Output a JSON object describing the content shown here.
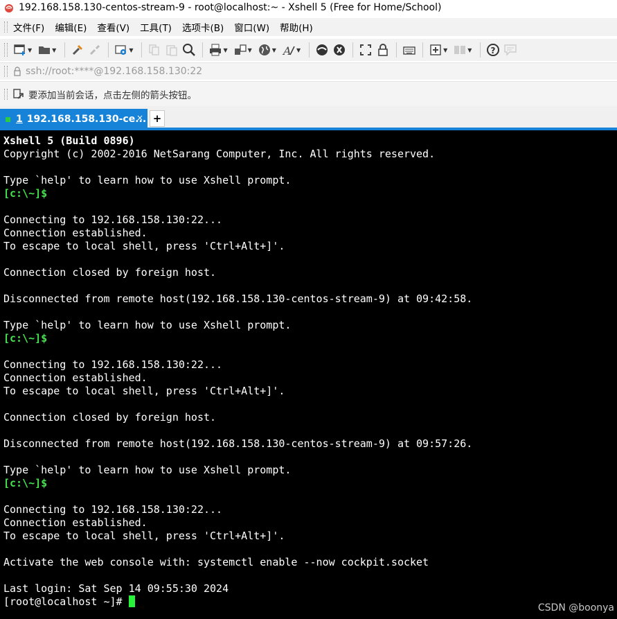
{
  "window": {
    "title": "192.168.158.130-centos-stream-9 - root@localhost:~ - Xshell 5 (Free for Home/School)",
    "app_icon": "xshell-icon"
  },
  "menu": [
    "文件(F)",
    "编辑(E)",
    "查看(V)",
    "工具(T)",
    "选项卡(B)",
    "窗口(W)",
    "帮助(H)"
  ],
  "toolbar": {
    "icons": [
      "new-session-icon",
      "open-folder-icon",
      "connect-icon",
      "disconnect-icon",
      "properties-icon",
      "copy-icon",
      "paste-icon",
      "find-icon",
      "print-icon",
      "transfer-icon",
      "globe-icon",
      "font-icon",
      "xftp-icon",
      "xmanager-icon",
      "fullscreen-icon",
      "lock-icon",
      "keyboard-icon",
      "add-tab-icon",
      "layout-icon",
      "help-icon",
      "chat-icon"
    ]
  },
  "address": {
    "icon": "lock-icon",
    "value": "ssh://root:****@192.168.158.130:22"
  },
  "hint": {
    "icon": "arrow-icon",
    "text": "要添加当前会话，点击左侧的箭头按钮。"
  },
  "tab": {
    "number": "1",
    "label": "192.168.158.130-ce...",
    "close": "×",
    "add": "+"
  },
  "terminal": {
    "lines": [
      {
        "text": "Xshell 5 (Build 0896)",
        "style": "bold"
      },
      {
        "text": "Copyright (c) 2002-2016 NetSarang Computer, Inc. All rights reserved.",
        "style": "normal"
      },
      {
        "text": "",
        "style": "normal"
      },
      {
        "text": "Type `help' to learn how to use Xshell prompt.",
        "style": "normal"
      },
      {
        "text": "[c:\\~]$",
        "style": "prompt"
      },
      {
        "text": "",
        "style": "normal"
      },
      {
        "text": "Connecting to 192.168.158.130:22...",
        "style": "normal"
      },
      {
        "text": "Connection established.",
        "style": "normal"
      },
      {
        "text": "To escape to local shell, press 'Ctrl+Alt+]'.",
        "style": "normal"
      },
      {
        "text": "",
        "style": "normal"
      },
      {
        "text": "Connection closed by foreign host.",
        "style": "normal"
      },
      {
        "text": "",
        "style": "normal"
      },
      {
        "text": "Disconnected from remote host(192.168.158.130-centos-stream-9) at 09:42:58.",
        "style": "normal"
      },
      {
        "text": "",
        "style": "normal"
      },
      {
        "text": "Type `help' to learn how to use Xshell prompt.",
        "style": "normal"
      },
      {
        "text": "[c:\\~]$",
        "style": "prompt"
      },
      {
        "text": "",
        "style": "normal"
      },
      {
        "text": "Connecting to 192.168.158.130:22...",
        "style": "normal"
      },
      {
        "text": "Connection established.",
        "style": "normal"
      },
      {
        "text": "To escape to local shell, press 'Ctrl+Alt+]'.",
        "style": "normal"
      },
      {
        "text": "",
        "style": "normal"
      },
      {
        "text": "Connection closed by foreign host.",
        "style": "normal"
      },
      {
        "text": "",
        "style": "normal"
      },
      {
        "text": "Disconnected from remote host(192.168.158.130-centos-stream-9) at 09:57:26.",
        "style": "normal"
      },
      {
        "text": "",
        "style": "normal"
      },
      {
        "text": "Type `help' to learn how to use Xshell prompt.",
        "style": "normal"
      },
      {
        "text": "[c:\\~]$",
        "style": "prompt"
      },
      {
        "text": "",
        "style": "normal"
      },
      {
        "text": "Connecting to 192.168.158.130:22...",
        "style": "normal"
      },
      {
        "text": "Connection established.",
        "style": "normal"
      },
      {
        "text": "To escape to local shell, press 'Ctrl+Alt+]'.",
        "style": "normal"
      },
      {
        "text": "",
        "style": "normal"
      },
      {
        "text": "Activate the web console with: systemctl enable --now cockpit.socket",
        "style": "normal"
      },
      {
        "text": "",
        "style": "normal"
      },
      {
        "text": "Last login: Sat Sep 14 09:55:30 2024",
        "style": "normal"
      }
    ],
    "current_prompt": "[root@localhost ~]# ",
    "cursor_color": "#27f33a"
  },
  "watermark": "CSDN @boonya",
  "colors": {
    "accent": "#1683d8",
    "prompt_green": "#47e04f",
    "terminal_bg": "#000000"
  }
}
